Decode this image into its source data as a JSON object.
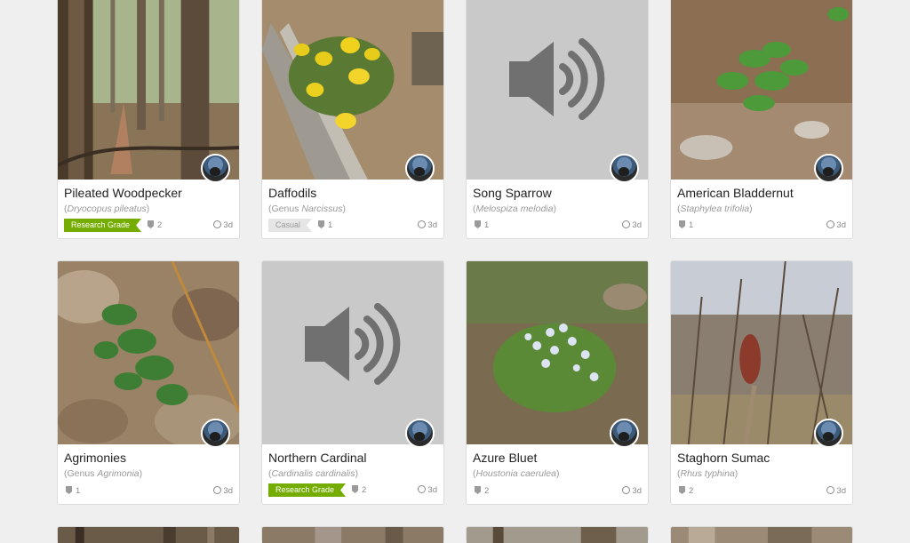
{
  "cards": [
    {
      "title": "Pileated Woodpecker",
      "sci_pre": "(",
      "sci_italic": "Dryocopus pileatus",
      "sci_post": ")",
      "badge": "Research Grade",
      "ids": "2",
      "time": "3d"
    },
    {
      "title": "Daffodils",
      "sci_pre": "(Genus ",
      "sci_italic": "Narcissus",
      "sci_post": ")",
      "badge": "Casual",
      "ids": "1",
      "time": "3d"
    },
    {
      "title": "Song Sparrow",
      "sci_pre": "(",
      "sci_italic": "Melospiza melodia",
      "sci_post": ")",
      "badge": "",
      "ids": "1",
      "time": "3d"
    },
    {
      "title": "American Bladdernut",
      "sci_pre": "(",
      "sci_italic": "Staphylea trifolia",
      "sci_post": ")",
      "badge": "",
      "ids": "1",
      "time": "3d"
    },
    {
      "title": "Agrimonies",
      "sci_pre": "(Genus ",
      "sci_italic": "Agrimonia",
      "sci_post": ")",
      "badge": "",
      "ids": "1",
      "time": "3d"
    },
    {
      "title": "Northern Cardinal",
      "sci_pre": "(",
      "sci_italic": "Cardinalis cardinalis",
      "sci_post": ")",
      "badge": "Research Grade",
      "ids": "2",
      "time": "3d"
    },
    {
      "title": "Azure Bluet",
      "sci_pre": "(",
      "sci_italic": "Houstonia caerulea",
      "sci_post": ")",
      "badge": "",
      "ids": "2",
      "time": "3d"
    },
    {
      "title": "Staghorn Sumac",
      "sci_pre": "(",
      "sci_italic": "Rhus typhina",
      "sci_post": ")",
      "badge": "",
      "ids": "2",
      "time": "3d"
    }
  ],
  "icons": {
    "sound": "speaker-icon",
    "identifications": "identification-icon",
    "time": "clock-icon"
  },
  "colors": {
    "research_grade": "#74ac00",
    "casual": "#e6e6e6",
    "sound_placeholder": "#c9c9c9"
  }
}
